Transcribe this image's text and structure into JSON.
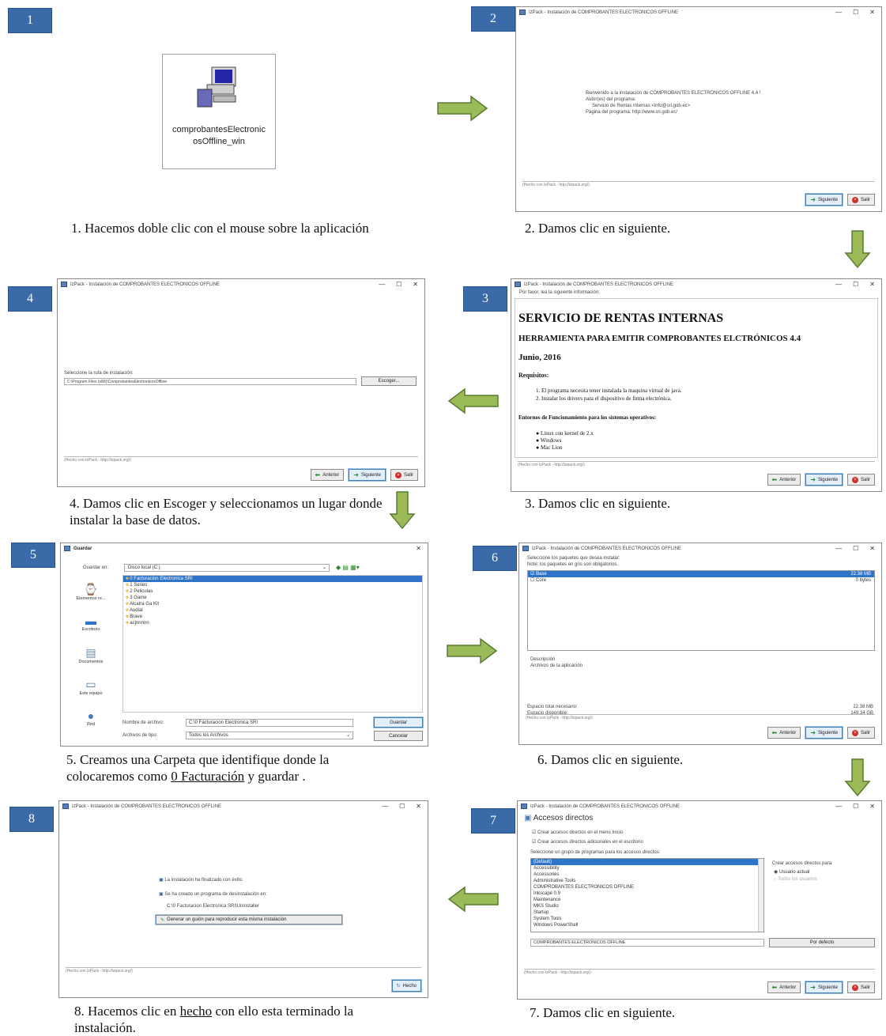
{
  "steps": [
    {
      "n": "1",
      "caption": "1. Hacemos doble clic con el mouse sobre la aplicación"
    },
    {
      "n": "2",
      "caption": "2. Damos clic en siguiente."
    },
    {
      "n": "3",
      "caption": "3. Damos clic en siguiente."
    },
    {
      "n": "4",
      "caption": "4. Damos clic en Escoger y seleccionamos un lugar donde instalar la base de datos."
    },
    {
      "n": "5",
      "caption_pre": "5. Creamos una Carpeta que identifique donde la colocaremos como ",
      "caption_u": "0 Facturación",
      "caption_post": " y guardar ."
    },
    {
      "n": "6",
      "caption": "6. Damos clic en siguiente."
    },
    {
      "n": "7",
      "caption": "7. Damos clic en siguiente."
    },
    {
      "n": "8",
      "caption_pre": "8. Hacemos clic en ",
      "caption_u": "hecho",
      "caption_post": "  con ello esta terminado la instalación."
    }
  ],
  "file_icon": {
    "label": "comprobantesElectronicosOffline_win"
  },
  "win_title": "IzPack - Instalación de  COMPROBANTES ELECTRONICOS OFFLINE",
  "made_with": "(Hecho con IzPack - http://izpack.org/)",
  "buttons": {
    "prev": "Anterior",
    "next": "Siguiente",
    "quit": "Salir",
    "done": "Hecho",
    "choose": "Escoger..."
  },
  "w2": {
    "welcome": "Bienvenido a la instalación de COMPROBANTES ELECTRONICOS OFFLINE 4.4 !",
    "authors": "Autor(es) del programa:",
    "author": "Servicio de Rentas Internas <info@sri.gob.ec>",
    "homepage": "Página del programa: http://www.sri.gob.ec/"
  },
  "w3": {
    "note": "Por favor, lea la siguiente información:",
    "h1": "SERVICIO DE RENTAS INTERNAS",
    "h2": "HERRAMIENTA PARA EMITIR COMPROBANTES ELCTRÓNICOS 4.4",
    "date": "Junio, 2016",
    "req": "Requisitos:",
    "req_items": [
      "El programa necesita tener instalada la maquina virtual de java.",
      "Instalar los drivers para el dispositivo de firma electrónica."
    ],
    "os_title": "Entornos de Funcionamiento para los sistemas operativos:",
    "os_items": [
      "Linux con kernel de 2.x",
      "Windows",
      "Mac Lion"
    ]
  },
  "w4": {
    "label": "Seleccione la ruta de instalación:",
    "path": "C:\\Program Files (x86)\\ComprobantesElectronicosOffline"
  },
  "w5": {
    "title": "Guardar",
    "save_in_label": "Guardar en:",
    "save_in": "Disco local (C:)",
    "places": [
      "Elementos re...",
      "Escritorio",
      "Documentos",
      "Este equipo",
      "Red"
    ],
    "files": [
      "0 Facturacion Electronica SRI",
      "1 Series",
      "2 Peliculas",
      "3 Game",
      "Alcatra Ga Kit",
      "Audial",
      "Brave",
      "acjnnnnn"
    ],
    "filename_label": "Nombre de archivo:",
    "filename": "C:\\0 Facturacion Electronica SRI",
    "filetype_label": "Archivos de tipo:",
    "filetype": "Todos los Archivos",
    "save": "Guardar",
    "cancel": "Cancelar"
  },
  "w6": {
    "line1": "Seleccione los paquetes que desea instalar:",
    "line2": "Note: los paquetes en gris son obligatorios.",
    "packages": [
      {
        "name": "Base",
        "size": "22.38 MB"
      },
      {
        "name": "Core",
        "size": "0 bytes"
      }
    ],
    "desc_label": "Descripción",
    "desc": "Archivos de la aplicación",
    "req_label": "Espacio total necesario:",
    "req_val": "22.38 MB",
    "avail_label": "Espacio disponible:",
    "avail_val": "149.34 GB"
  },
  "w7": {
    "heading": "Accesos directos",
    "cb1": "Crear accesos directos en el menú Inicio",
    "cb2": "Crear accesos directos adicionales en el escritorio",
    "group_label": "Seleccione un grupo de programas para los accesos directos:",
    "groups": [
      "(Default)",
      "Accessibility",
      "Accessories",
      "Administrative Tools",
      "COMPROBANTES ELECTRONICOS OFFLINE",
      "Inkscape 0.9",
      "Maintenance",
      "MKS Studio",
      "Startup",
      "System Tools",
      "Windows PowerShell"
    ],
    "group_value": "COMPROBANTES ELECTRONICOS OFFLINE",
    "for_label": "Crear accesos directos para:",
    "current_user": "Usuario actual",
    "all_users": "Todos los usuarios",
    "default_btn": "Por defecto"
  },
  "w8": {
    "l1": "La instalación ha finalizado con éxito.",
    "l2": "Se ha creado un programa de desinstalación en:",
    "l3": "C:\\0 Facturacion Electronica SRI\\Uninstaller",
    "l4": "Generar un guión para reproducir esta misma instalación"
  },
  "colors": {
    "badge": "#3a6aa8",
    "arrow": "#9bbb59",
    "arrow_border": "#5a7a32"
  }
}
